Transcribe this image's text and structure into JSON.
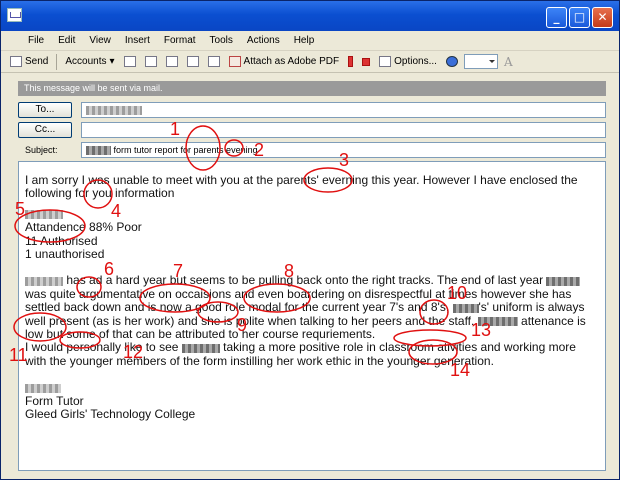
{
  "menu": [
    "File",
    "Edit",
    "View",
    "Insert",
    "Format",
    "Tools",
    "Actions",
    "Help"
  ],
  "toolbar": {
    "send": "Send",
    "accounts": "Accounts",
    "attach_pdf": "Attach as Adobe PDF",
    "options": "Options..."
  },
  "info_bar": "This message will be sent via mail.",
  "header": {
    "to_label": "To...",
    "cc_label": "Cc...",
    "subject_label": "Subject:",
    "subject_value": "form tutor report for parents evening"
  },
  "message": {
    "p1": "I am sorry I was unable to meet with you at the parents' everning this year. However I have enclosed the following for you information",
    "attendance": "Attandence 88% Poor",
    "authorised": "11 Authorised",
    "unauthorised": "1 unauthorised",
    "p2a": "has ad a hard year but seems to be pulling back onto the right tracks. The end of last year",
    "p2b": "was quite argumentative on occaisions and even boardering on disrespectful at times however she has settled back down and is now a good role modal for the current year 7's and 8's,",
    "p2c": "'s' uniform is always well present (as is her work) and she is polite when talking to her peers and the staff.",
    "p2d": "attenance is low but some of that can be attributed to her course requriements.",
    "p3a": "I would personally like to see",
    "p3b": "taking a more positive role in classroom ativities and working more with the younger members of the form instilling her work ethic in the younger generation.",
    "sig_role": "Form Tutor",
    "sig_school": "Gleed Girls' Technology College"
  },
  "annotation_numbers": [
    "1",
    "2",
    "3",
    "4",
    "5",
    "6",
    "7",
    "8",
    "9",
    "10",
    "11",
    "12",
    "13",
    "14"
  ],
  "colors": {
    "annotation": "#e01010",
    "titlebar": "#0a46c4",
    "info_bar": "#9a9a9a"
  }
}
